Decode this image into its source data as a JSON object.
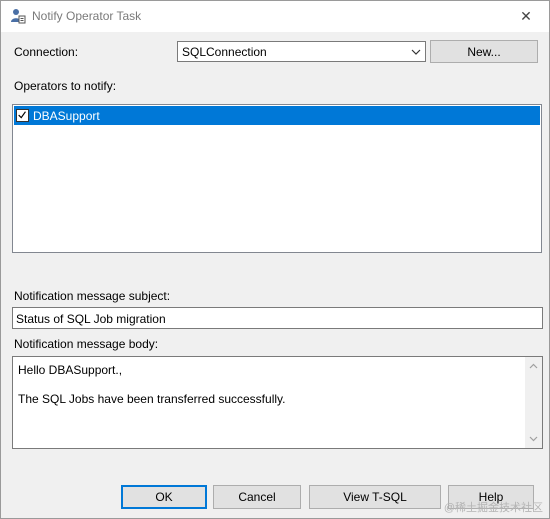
{
  "window": {
    "title": "Notify Operator Task",
    "close_glyph": "✕"
  },
  "connection": {
    "label": "Connection:",
    "value": "SQLConnection",
    "new_button": "New..."
  },
  "operators": {
    "label": "Operators to notify:",
    "items": [
      {
        "name": "DBASupport",
        "checked": true,
        "selected": true
      }
    ]
  },
  "subject": {
    "label": "Notification message subject:",
    "value": "Status of SQL Job migration"
  },
  "body": {
    "label": "Notification message body:",
    "lines": [
      "Hello DBASupport.,",
      "",
      "The SQL Jobs have been transferred successfully."
    ]
  },
  "buttons": {
    "ok": "OK",
    "cancel": "Cancel",
    "view_tsql": "View T-SQL",
    "help": "Help"
  },
  "watermark": "@稀土掘金技术社区",
  "colors": {
    "selection": "#0078d7",
    "default_button_border": "#0078d7",
    "dialog_bg": "#f0f0f0"
  },
  "icons": {
    "title": "operator-task-icon",
    "dropdown": "chevron-down-icon",
    "checkbox": "checkmark-icon"
  }
}
